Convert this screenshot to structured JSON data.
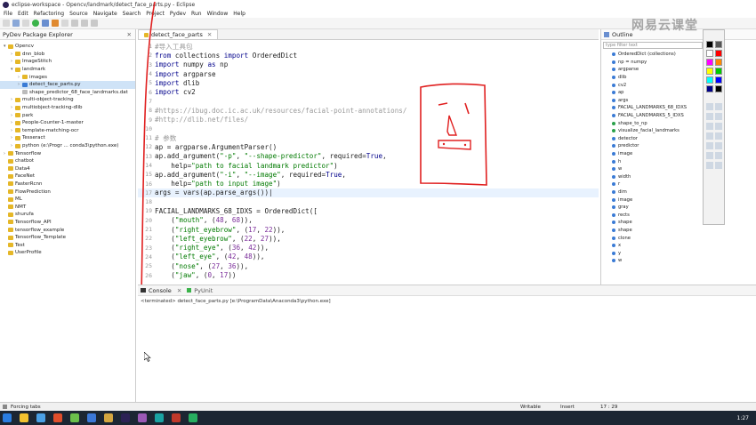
{
  "window": {
    "title": "eclipse-workspace - Opencv/landmark/detect_face_parts.py - Eclipse"
  },
  "menu": [
    "File",
    "Edit",
    "Refactoring",
    "Source",
    "Navigate",
    "Search",
    "Project",
    "Pydev",
    "Run",
    "Window",
    "Help"
  ],
  "left_panel": {
    "title": "PyDev Package Explorer",
    "items": [
      {
        "label": "Opencv",
        "indent": 0,
        "twisty": "▾"
      },
      {
        "label": "dnn_blob",
        "indent": 1,
        "twisty": "›"
      },
      {
        "label": "ImageStitch",
        "indent": 1,
        "twisty": "›"
      },
      {
        "label": "landmark",
        "indent": 1,
        "twisty": "▾"
      },
      {
        "label": "images",
        "indent": 2,
        "twisty": "›"
      },
      {
        "label": "detect_face_parts.py",
        "indent": 2,
        "twisty": "›",
        "selected": true
      },
      {
        "label": "shape_predictor_68_face_landmarks.dat",
        "indent": 2,
        "twisty": ""
      },
      {
        "label": "multi-object-tracking",
        "indent": 1,
        "twisty": "›"
      },
      {
        "label": "multiobject-tracking-dlib",
        "indent": 1,
        "twisty": "›"
      },
      {
        "label": "park",
        "indent": 1,
        "twisty": "›"
      },
      {
        "label": "People-Counter-1-master",
        "indent": 1,
        "twisty": "›"
      },
      {
        "label": "template-matching-ocr",
        "indent": 1,
        "twisty": "›"
      },
      {
        "label": "Tesseract",
        "indent": 1,
        "twisty": "›"
      },
      {
        "label": "python (e:\\Progr ... conda3\\python.exe)",
        "indent": 1,
        "twisty": "›"
      },
      {
        "label": "Tensorflow",
        "indent": 0,
        "twisty": "›"
      },
      {
        "label": "chatbot",
        "indent": 0,
        "twisty": ""
      },
      {
        "label": "Data4",
        "indent": 0,
        "twisty": ""
      },
      {
        "label": "FaceNet",
        "indent": 0,
        "twisty": ""
      },
      {
        "label": "FasterRcnn",
        "indent": 0,
        "twisty": ""
      },
      {
        "label": "FlowPrediction",
        "indent": 0,
        "twisty": ""
      },
      {
        "label": "ML",
        "indent": 0,
        "twisty": ""
      },
      {
        "label": "NMT",
        "indent": 0,
        "twisty": ""
      },
      {
        "label": "shurufa",
        "indent": 0,
        "twisty": ""
      },
      {
        "label": "Tensorflow_API",
        "indent": 0,
        "twisty": ""
      },
      {
        "label": "tensorflow_example",
        "indent": 0,
        "twisty": ""
      },
      {
        "label": "Tensorflow_Template",
        "indent": 0,
        "twisty": ""
      },
      {
        "label": "Test",
        "indent": 0,
        "twisty": ""
      },
      {
        "label": "UserProfile",
        "indent": 0,
        "twisty": ""
      }
    ]
  },
  "editor": {
    "tab_label": "detect_face_parts",
    "tab_close": "✕",
    "lines": [
      {
        "n": "1",
        "html": "<span class='cmt'>#导入工具包</span>"
      },
      {
        "n": "2",
        "html": "<span class='kw'>from</span> collections <span class='kw'>import</span> OrderedDict"
      },
      {
        "n": "3",
        "html": "<span class='kw'>import</span> numpy <span class='kw'>as</span> np"
      },
      {
        "n": "4",
        "html": "<span class='kw'>import</span> argparse"
      },
      {
        "n": "5",
        "html": "<span class='kw'>import</span> dlib"
      },
      {
        "n": "6",
        "html": "<span class='kw'>import</span> cv2"
      },
      {
        "n": "7",
        "html": ""
      },
      {
        "n": "8",
        "html": "<span class='cmt'>#https://ibug.doc.ic.ac.uk/resources/facial-point-annotations/</span>"
      },
      {
        "n": "9",
        "html": "<span class='cmt'>#http://dlib.net/files/</span>"
      },
      {
        "n": "10",
        "html": ""
      },
      {
        "n": "11",
        "html": "<span class='cmt'># 参数</span>"
      },
      {
        "n": "12",
        "html": "ap = argparse.ArgumentParser()"
      },
      {
        "n": "13",
        "html": "ap.add_argument(<span class='str'>\"-p\"</span>, <span class='str'>\"--shape-predictor\"</span>, required=<span class='kw'>True</span>,"
      },
      {
        "n": "14",
        "html": "    help=<span class='str'>\"path to facial landmark predictor\"</span>)"
      },
      {
        "n": "15",
        "html": "ap.add_argument(<span class='str'>\"-i\"</span>, <span class='str'>\"--image\"</span>, required=<span class='kw'>True</span>,"
      },
      {
        "n": "16",
        "html": "    help=<span class='str'>\"path to input image\"</span>)"
      },
      {
        "n": "17",
        "html": "args = vars(ap.parse_args())|",
        "hl": true
      },
      {
        "n": "18",
        "html": ""
      },
      {
        "n": "19",
        "html": "FACIAL_LANDMARKS_68_IDXS = OrderedDict(["
      },
      {
        "n": "20",
        "html": "    (<span class='str'>\"mouth\"</span>, (<span class='num'>48</span>, <span class='num'>68</span>)),"
      },
      {
        "n": "21",
        "html": "    (<span class='str'>\"right_eyebrow\"</span>, (<span class='num'>17</span>, <span class='num'>22</span>)),"
      },
      {
        "n": "22",
        "html": "    (<span class='str'>\"left_eyebrow\"</span>, (<span class='num'>22</span>, <span class='num'>27</span>)),"
      },
      {
        "n": "23",
        "html": "    (<span class='str'>\"right_eye\"</span>, (<span class='num'>36</span>, <span class='num'>42</span>)),"
      },
      {
        "n": "24",
        "html": "    (<span class='str'>\"left_eye\"</span>, (<span class='num'>42</span>, <span class='num'>48</span>)),"
      },
      {
        "n": "25",
        "html": "    (<span class='str'>\"nose\"</span>, (<span class='num'>27</span>, <span class='num'>36</span>)),"
      },
      {
        "n": "26",
        "html": "    (<span class='str'>\"jaw\"</span>, (<span class='num'>0</span>, <span class='num'>17</span>))"
      }
    ]
  },
  "outline": {
    "title": "Outline",
    "filter_placeholder": "type filter text",
    "items": [
      {
        "label": "OrderedDict (collections)",
        "color": "#3a7bd5"
      },
      {
        "label": "np = numpy",
        "color": "#3a7bd5"
      },
      {
        "label": "argparse",
        "color": "#3a7bd5"
      },
      {
        "label": "dlib",
        "color": "#3a7bd5"
      },
      {
        "label": "cv2",
        "color": "#3a7bd5"
      },
      {
        "label": "ap",
        "color": "#3a7bd5"
      },
      {
        "label": "args",
        "color": "#3a7bd5"
      },
      {
        "label": "FACIAL_LANDMARKS_68_IDXS",
        "color": "#3a7bd5"
      },
      {
        "label": "FACIAL_LANDMARKS_5_IDXS",
        "color": "#3a7bd5"
      },
      {
        "label": "shape_to_np",
        "color": "#2aa14a"
      },
      {
        "label": "visualize_facial_landmarks",
        "color": "#2aa14a"
      },
      {
        "label": "detector",
        "color": "#3a7bd5"
      },
      {
        "label": "predictor",
        "color": "#3a7bd5"
      },
      {
        "label": "image",
        "color": "#3a7bd5"
      },
      {
        "label": "h",
        "color": "#3a7bd5"
      },
      {
        "label": "w",
        "color": "#3a7bd5"
      },
      {
        "label": "width",
        "color": "#3a7bd5"
      },
      {
        "label": "r",
        "color": "#3a7bd5"
      },
      {
        "label": "dim",
        "color": "#3a7bd5"
      },
      {
        "label": "image",
        "color": "#3a7bd5"
      },
      {
        "label": "gray",
        "color": "#3a7bd5"
      },
      {
        "label": "rects",
        "color": "#3a7bd5"
      },
      {
        "label": "shape",
        "color": "#3a7bd5"
      },
      {
        "label": "shape",
        "color": "#3a7bd5"
      },
      {
        "label": "clone",
        "color": "#3a7bd5"
      },
      {
        "label": "x",
        "color": "#3a7bd5"
      },
      {
        "label": "y",
        "color": "#3a7bd5"
      },
      {
        "label": "w",
        "color": "#3a7bd5"
      }
    ]
  },
  "console": {
    "tab_label": "Console",
    "tab2_label": "PyUnit",
    "terminated": "<terminated> detect_face_parts.py [e:\\ProgramData\\Anaconda3\\python.exe]"
  },
  "statusbar": {
    "message": "Forcing tabs",
    "writable": "Writable",
    "insert": "Insert",
    "position": "17 : 29"
  },
  "taskbar": {
    "clock": "1:27"
  },
  "watermark": "网易云课堂",
  "palette_colors": [
    "#000000",
    "#555555",
    "#ffffff",
    "#ff0000",
    "#ff00ff",
    "#ff8800",
    "#ffff00",
    "#00cc00",
    "#00ffff",
    "#0000ff",
    "#000088",
    "#000000"
  ],
  "colors": {
    "annotation": "#e02020",
    "accent": "#3a7bd5"
  }
}
